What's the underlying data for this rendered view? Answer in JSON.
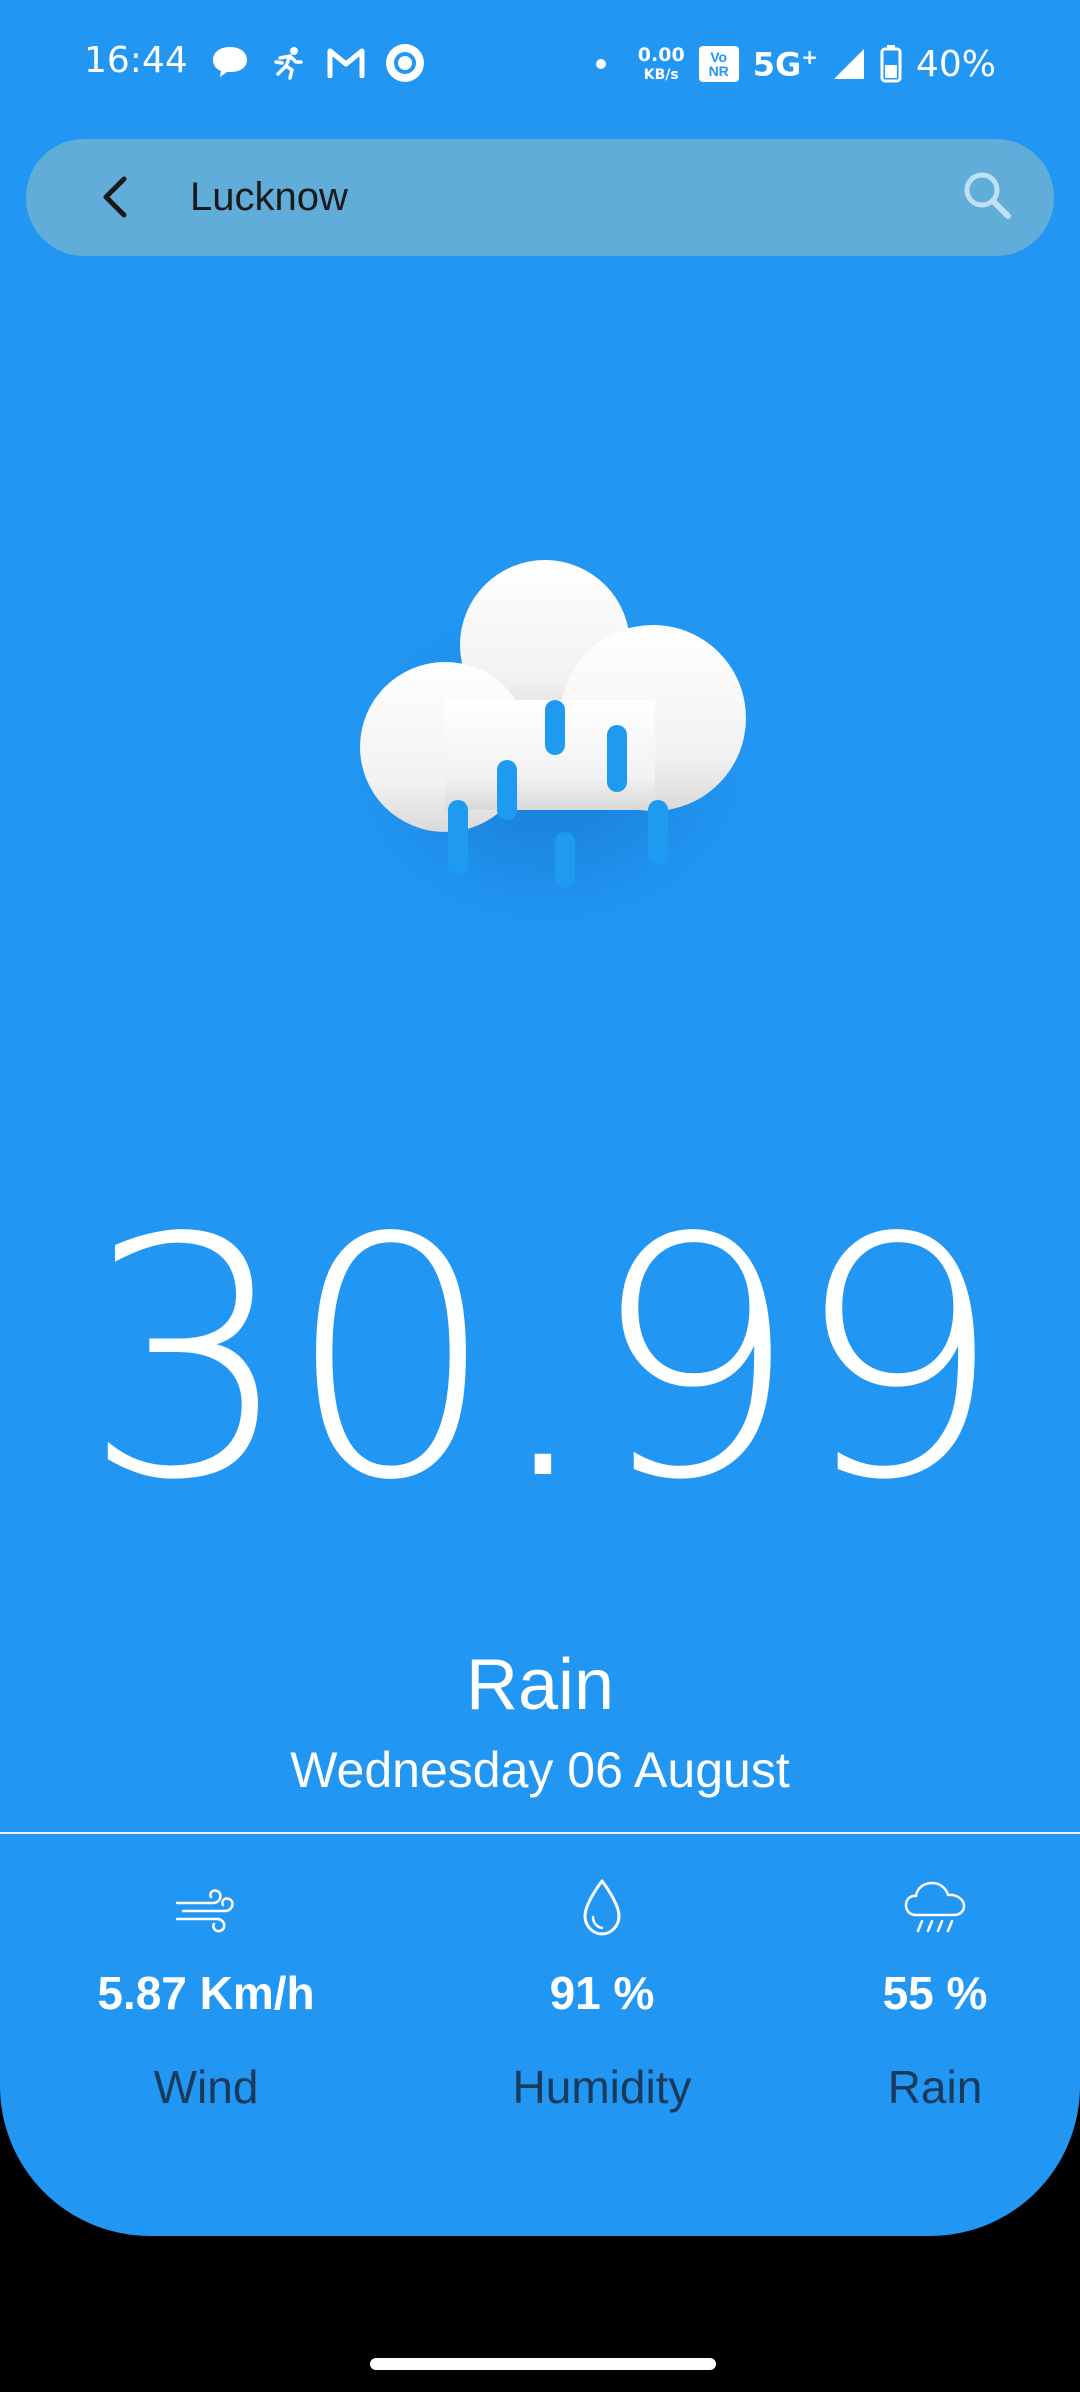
{
  "status_bar": {
    "time": "16:44",
    "net_speed_value": "0.00",
    "net_speed_unit": "KB/s",
    "vonr_top": "Vo",
    "vonr_bottom": "NR",
    "network": "5G",
    "network_plus": "+",
    "battery_percent": "40%"
  },
  "search": {
    "value": "Lucknow"
  },
  "weather": {
    "icon": "rain-cloud-icon",
    "temperature": "30.99",
    "condition": "Rain",
    "date": "Wednesday 06 August"
  },
  "stats": {
    "wind": {
      "icon": "wind-icon",
      "value": "5.87 Km/h",
      "label": "Wind"
    },
    "humidity": {
      "icon": "water-drop-icon",
      "value": "91 %",
      "label": "Humidity"
    },
    "rain": {
      "icon": "rain-icon",
      "value": "55 %",
      "label": "Rain"
    }
  },
  "colors": {
    "background": "#2196F3",
    "search_bar": "#61ADD9",
    "label_text": "#1A3A5C",
    "rain_drops": "#1E9BF0"
  }
}
